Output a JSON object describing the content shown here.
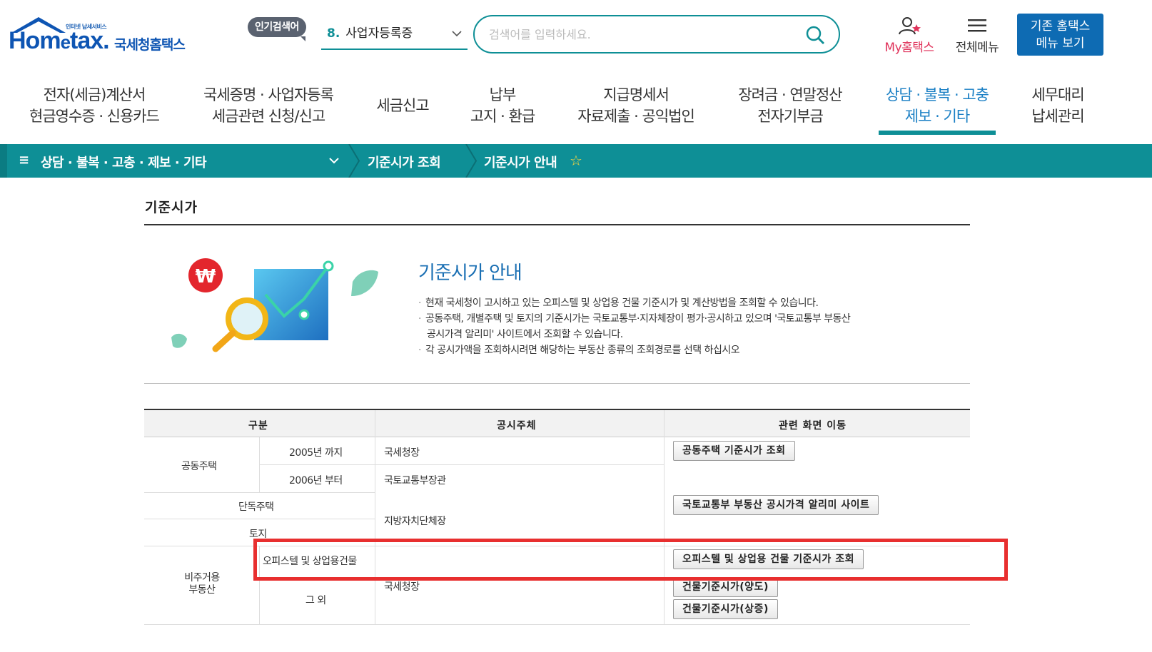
{
  "header": {
    "logo_small": "인터넷 납세서비스",
    "logo_main_pre": "Hom",
    "logo_main_e": "e",
    "logo_main_post": "tax.",
    "logo_sub": "국세청홈택스",
    "popular_label": "인기검색어",
    "popular_rank": "8.",
    "popular_keyword": "사업자등록증",
    "search_placeholder": "검색어를 입력하세요.",
    "my_hometax": "My홈택스",
    "all_menu": "전체메뉴",
    "old_menu_line1": "기존 홈택스",
    "old_menu_line2": "메뉴 보기"
  },
  "nav": [
    {
      "line1": "전자(세금)계산서",
      "line2": "현금영수증 · 신용카드"
    },
    {
      "line1": "국세증명 · 사업자등록",
      "line2": "세금관련 신청/신고"
    },
    {
      "line1": "세금신고",
      "line2": ""
    },
    {
      "line1": "납부",
      "line2": "고지 · 환급"
    },
    {
      "line1": "지급명세서",
      "line2": "자료제출 · 공익법인"
    },
    {
      "line1": "장려금 · 연말정산",
      "line2": "전자기부금"
    },
    {
      "line1": "상담 · 불복 · 고충",
      "line2": "제보 · 기타"
    },
    {
      "line1": "세무대리",
      "line2": "납세관리"
    }
  ],
  "breadcrumb": {
    "menu_icon": "≡",
    "level1": "상담 · 불복 · 고충 · 제보 · 기타",
    "level2": "기준시가 조회",
    "level3": "기준시가 안내",
    "star": "☆"
  },
  "page": {
    "title": "기준시가",
    "info_title": "기준시가 안내",
    "info_items": [
      "현재 국세청이 고시하고 있는 오피스텔 및 상업용 건물 기준시가 및 계산방법을 조회할 수 있습니다.",
      "공동주택, 개별주택 및 토지의 기준시가는 국토교통부·지자체장이 평가·공시하고 있으며 '국토교통부 부동산",
      "공시가격 알리미' 사이트에서 조회할 수 있습니다.",
      "각 공시가액을 조회하시려면 해당하는 부동산 종류의 조회경로를 선택 하십시오"
    ],
    "bullet": "·",
    "illustration_won": "₩"
  },
  "table": {
    "headers": [
      "구분",
      "공시주체",
      "관련 화면 이동"
    ],
    "group_apartment": "공동주택",
    "apt_until_2005": "2005년 까지",
    "apt_from_2006": "2006년 부터",
    "authority_nts": "국세청장",
    "authority_molit": "국토교통부장관",
    "detached_house": "단독주택",
    "land": "토지",
    "authority_local": "지방자치단체장",
    "group_nonresidential_1": "비주거용",
    "group_nonresidential_2": "부동산",
    "officetel": "오피스텔 및 상업용건물",
    "others": "그 외",
    "authority_nts_2": "국세청장",
    "btn_apt": "공동주택 기준시가 조회",
    "btn_molit": "국토교통부 부동산 공시가격 알리미 사이트",
    "btn_officetel": "오피스텔 및 상업용 건물 기준시가 조회",
    "btn_bldg_transfer": "건물기준시가(양도)",
    "btn_bldg_inherit": "건물기준시가(상증)"
  },
  "colors": {
    "teal": "#0e8f96",
    "brand_blue": "#0e55b3",
    "highlight_red": "#e82f2f",
    "my_pink": "#e0335b"
  }
}
